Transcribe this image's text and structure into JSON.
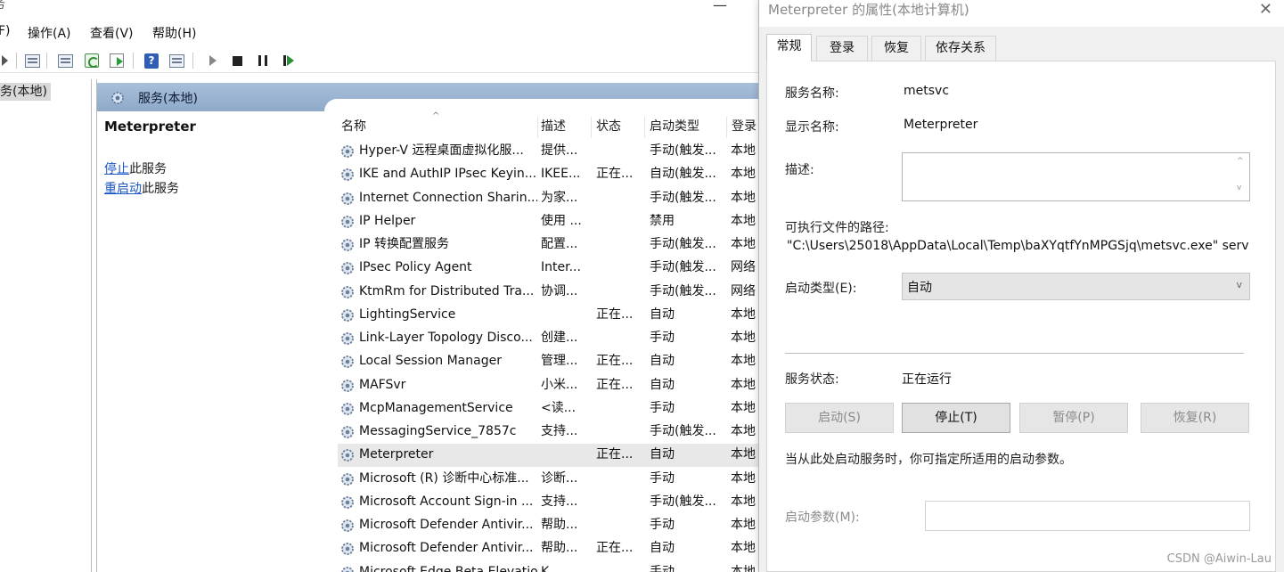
{
  "services_window": {
    "title_fragment": "务",
    "minimize_glyph": "—",
    "menu": {
      "file_fragment": "F)",
      "action": "操作(A)",
      "view": "查看(V)",
      "help": "帮助(H)"
    },
    "tree": {
      "item": "务(本地)"
    },
    "pane_header": "服务(本地)",
    "detail": {
      "service_name": "Meterpreter",
      "stop_link": "停止",
      "stop_suffix": "此服务",
      "restart_link": "重启动",
      "restart_suffix": "此服务"
    },
    "columns": {
      "name": "名称",
      "desc": "描述",
      "status": "状态",
      "startup": "启动类型",
      "logon": "登录"
    },
    "rows": [
      {
        "name": "Hyper-V 远程桌面虚拟化服...",
        "desc": "提供...",
        "status": "",
        "startup": "手动(触发...",
        "logon": "本地"
      },
      {
        "name": "IKE and AuthIP IPsec Keyin...",
        "desc": "IKEE...",
        "status": "正在...",
        "startup": "自动(触发...",
        "logon": "本地"
      },
      {
        "name": "Internet Connection Sharin...",
        "desc": "为家...",
        "status": "",
        "startup": "手动(触发...",
        "logon": "本地"
      },
      {
        "name": "IP Helper",
        "desc": "使用 ...",
        "status": "",
        "startup": "禁用",
        "logon": "本地"
      },
      {
        "name": "IP 转换配置服务",
        "desc": "配置...",
        "status": "",
        "startup": "手动(触发...",
        "logon": "本地"
      },
      {
        "name": "IPsec Policy Agent",
        "desc": "Inter...",
        "status": "",
        "startup": "手动(触发...",
        "logon": "网络"
      },
      {
        "name": "KtmRm for Distributed Tra...",
        "desc": "协调...",
        "status": "",
        "startup": "手动(触发...",
        "logon": "网络"
      },
      {
        "name": "LightingService",
        "desc": "",
        "status": "正在...",
        "startup": "自动",
        "logon": "本地"
      },
      {
        "name": "Link-Layer Topology Disco...",
        "desc": "创建...",
        "status": "",
        "startup": "手动",
        "logon": "本地"
      },
      {
        "name": "Local Session Manager",
        "desc": "管理...",
        "status": "正在...",
        "startup": "自动",
        "logon": "本地"
      },
      {
        "name": "MAFSvr",
        "desc": "小米...",
        "status": "正在...",
        "startup": "自动",
        "logon": "本地"
      },
      {
        "name": "McpManagementService",
        "desc": "<读...",
        "status": "",
        "startup": "手动",
        "logon": "本地"
      },
      {
        "name": "MessagingService_7857c",
        "desc": "支持...",
        "status": "",
        "startup": "手动(触发...",
        "logon": "本地"
      },
      {
        "name": "Meterpreter",
        "desc": "",
        "status": "正在...",
        "startup": "自动",
        "logon": "本地",
        "selected": true
      },
      {
        "name": "Microsoft (R) 诊断中心标准...",
        "desc": "诊断...",
        "status": "",
        "startup": "手动",
        "logon": "本地"
      },
      {
        "name": "Microsoft Account Sign-in ...",
        "desc": "支持...",
        "status": "",
        "startup": "手动(触发...",
        "logon": "本地"
      },
      {
        "name": "Microsoft Defender Antivir...",
        "desc": "帮助...",
        "status": "",
        "startup": "手动",
        "logon": "本地"
      },
      {
        "name": "Microsoft Defender Antivir...",
        "desc": "帮助...",
        "status": "正在...",
        "startup": "自动",
        "logon": "本地"
      },
      {
        "name": "Microsoft Edge Beta Elevation...",
        "desc": "K...",
        "status": "",
        "startup": "手动",
        "logon": "本地"
      }
    ]
  },
  "dialog": {
    "title": "Meterpreter 的属性(本地计算机)",
    "close_glyph": "✕",
    "tabs": [
      "常规",
      "登录",
      "恢复",
      "依存关系"
    ],
    "labels": {
      "service_name": "服务名称:",
      "display_name": "显示名称:",
      "description": "描述:",
      "exe_path": "可执行文件的路径:",
      "startup_type": "启动类型(E):",
      "service_status": "服务状态:",
      "hint": "当从此处启动服务时，你可指定所适用的启动参数。",
      "start_params": "启动参数(M):"
    },
    "values": {
      "service_name": "metsvc",
      "display_name": "Meterpreter",
      "exe_path": "\"C:\\Users\\25018\\AppData\\Local\\Temp\\baXYqtfYnMPGSjq\\metsvc.exe\" serv",
      "startup_type": "自动",
      "service_status": "正在运行"
    },
    "buttons": {
      "start": "启动(S)",
      "stop": "停止(T)",
      "pause": "暂停(P)",
      "resume": "恢复(R)"
    }
  },
  "watermark": "CSDN @Aiwin-Lau",
  "colors": {
    "header_blue": "#9bb3d1",
    "link_blue": "#1a56c4",
    "selected_row": "#e8e8e8",
    "dialog_bg": "#f0f0f0"
  }
}
